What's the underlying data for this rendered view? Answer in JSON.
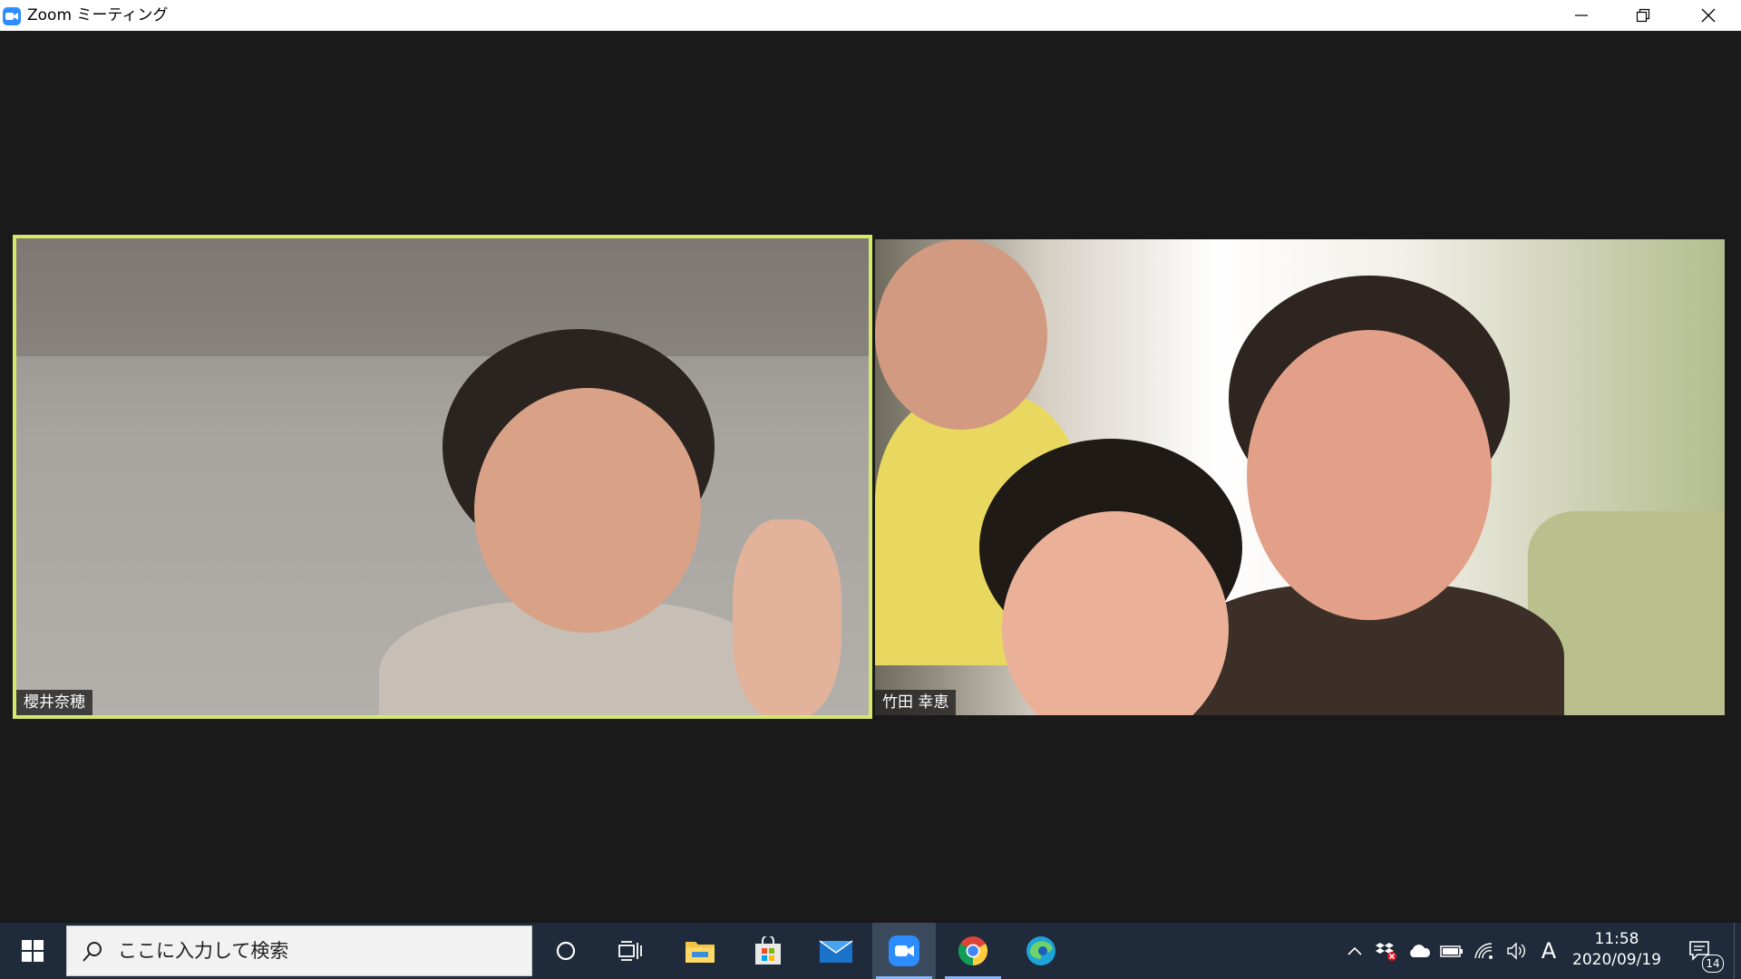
{
  "window": {
    "title": "Zoom ミーティング",
    "controls": {
      "minimize": "minimize",
      "maximize": "restore",
      "close": "close"
    }
  },
  "meeting": {
    "participants": [
      {
        "name": "櫻井奈穂",
        "active_speaker": true
      },
      {
        "name": "竹田 幸恵",
        "active_speaker": false
      }
    ],
    "active_speaker_border_color": "#d6e86a"
  },
  "taskbar": {
    "search_placeholder": "ここに入力して検索",
    "apps": [
      {
        "icon": "cortana-icon"
      },
      {
        "icon": "task-view-icon"
      },
      {
        "icon": "file-explorer-icon"
      },
      {
        "icon": "microsoft-store-icon"
      },
      {
        "icon": "mail-icon"
      },
      {
        "icon": "zoom-icon",
        "active": true
      },
      {
        "icon": "chrome-icon",
        "running": true
      },
      {
        "icon": "edge-icon"
      }
    ],
    "tray": {
      "ime": "A",
      "time": "11:58",
      "date": "2020/09/19",
      "notifications": "14"
    }
  }
}
